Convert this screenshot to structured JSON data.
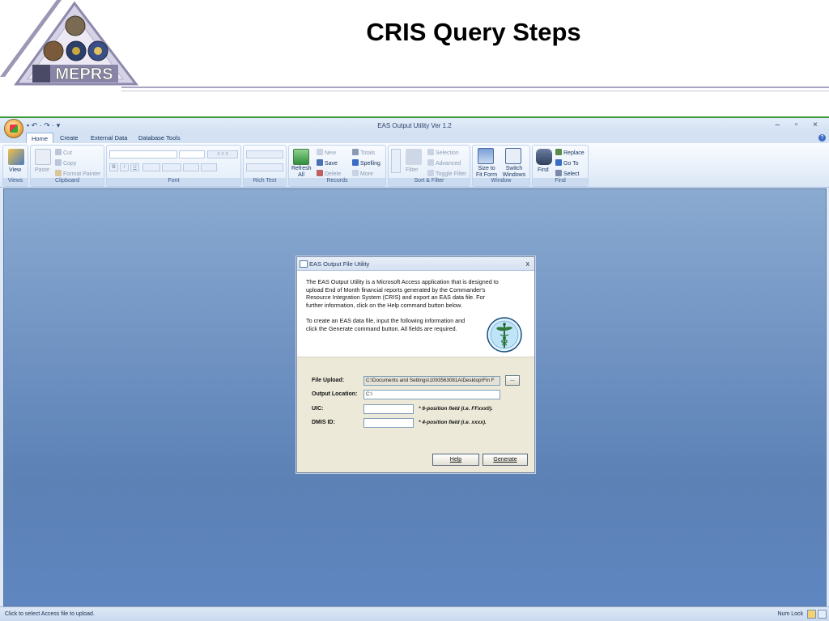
{
  "slide": {
    "title": "CRIS Query Steps",
    "logo_text": "MEPRS"
  },
  "app": {
    "window_title": "EAS Output Utility Ver 1.2",
    "window_controls": "– ▫ ×",
    "qat": "▪ ↶ · ↷ · ▾",
    "tabs": [
      "Home",
      "Create",
      "External Data",
      "Database Tools"
    ],
    "ribbon": {
      "groups": [
        "Views",
        "Clipboard",
        "Font",
        "Rich Text",
        "Records",
        "Sort & Filter",
        "Window",
        "Find"
      ],
      "views": {
        "view": "View"
      },
      "clipboard": {
        "paste": "Paste",
        "cut": "Cut",
        "copy": "Copy",
        "format_painter": "Format Painter"
      },
      "font": {
        "bold": "B",
        "italic": "I",
        "underline": "U"
      },
      "records": {
        "refresh_all": "Refresh All",
        "new": "New",
        "save": "Save",
        "delete": "Delete",
        "totals": "Totals",
        "spelling": "Spelling",
        "more": "More"
      },
      "sort_filter": {
        "filter": "Filter",
        "selection": "Selection",
        "advanced": "Advanced",
        "toggle_filter": "Toggle Filter"
      },
      "window": {
        "size_to_fit": "Size to Fit Form",
        "switch_windows": "Switch Windows"
      },
      "find": {
        "find": "Find",
        "replace": "Replace",
        "go_to": "Go To",
        "select": "Select"
      }
    },
    "status": {
      "text": "Click to select Access file to upload.",
      "num_lock": "Num Lock"
    }
  },
  "dialog": {
    "title": "EAS Output File Utility",
    "close": "x",
    "para1": [
      "The EAS Output Utility is a Microsoft Access application that is designed to",
      "upload End of Month financial reports generated by the Commander's",
      "Resource Integration System (CRIS) and export an EAS data file.  For",
      "further information, click on the Help command button below."
    ],
    "para2": [
      "To create an EAS data file, input the following information and",
      "click the Generate command button.  All fields are required."
    ],
    "fields": {
      "file_upload": {
        "label": "File Upload:",
        "value": "C:\\Documents and Settings\\1093563081A\\Desktop\\Fin F"
      },
      "browse": "...",
      "output_location": {
        "label": "Output Location:",
        "value": "C:\\"
      },
      "uic": {
        "label": "UIC:",
        "value": "",
        "note": "* 6-position field (i.e. FFxxx0)."
      },
      "dmis_id": {
        "label": "DMIS ID:",
        "value": "",
        "note": "* 4-position field (i.e. xxxx)."
      }
    },
    "buttons": {
      "help": "Help",
      "generate": "Generate"
    }
  },
  "colors": {
    "workspace_top": "#8aaad0",
    "workspace_bottom": "#5f86c0",
    "dialog_bg": "#ece9d8",
    "accent_green": "#3a9a3a"
  }
}
